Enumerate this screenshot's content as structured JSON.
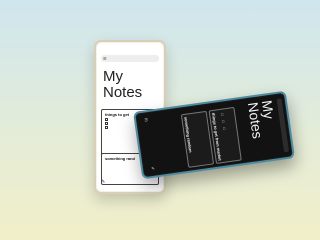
{
  "light_phone": {
    "search_icon": "☰",
    "title_line1": "My",
    "title_line2": "Notes",
    "card1_title": "things to get",
    "checklist": [
      "",
      "",
      ""
    ],
    "card2_title": "something rand"
  },
  "dark_phone": {
    "title_line1": "My",
    "title_line2": "Notes",
    "card1_title": "things to get from market",
    "card2_title": "something random"
  },
  "colors": {
    "background_top": "#cfe6ee",
    "background_bottom": "#f1efc9",
    "dark_frame": "#4e8aa0",
    "light_frame": "#d8cfb6"
  }
}
